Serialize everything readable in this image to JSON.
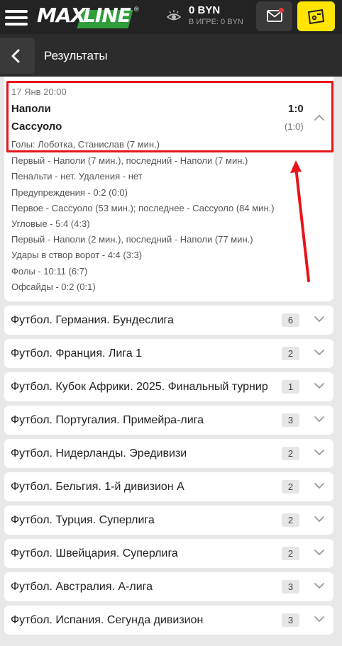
{
  "header": {
    "logo_text_1": "MAX",
    "logo_text_2": "LINE",
    "logo_reg": "®",
    "balance": "0 BYN",
    "in_game": "В ИГРЕ: 0 BYN",
    "colors": {
      "topbar": "#232323",
      "accent_yellow": "#ffe500",
      "logo_green": "#2f9d3c",
      "notify_red": "#e53935"
    }
  },
  "subheader": {
    "title": "Результаты"
  },
  "match": {
    "date": "17 Янв 20:00",
    "team1": "Наполи",
    "team2": "Сассуоло",
    "score": "1:0",
    "half_score": "(1:0)",
    "goals": "Голы: Лоботка, Станислав (7 мин.)",
    "details": [
      "Первый - Наполи (7 мин.), последний - Наполи (7 мин.)",
      "Пенальти - нет. Удаления - нет",
      "Предупреждения - 0:2 (0:0)",
      "Первое - Сассуоло (53 мин.); последнее - Сассуоло (84 мин.)",
      "Угловые - 5:4 (4:3)",
      "Первый - Наполи (2 мин.), последний - Наполи (77 мин.)",
      "Удары в створ ворот - 4:4 (3:3)",
      "Фолы - 10:11 (6:7)",
      "Офсайды - 0:2 (0:1)"
    ],
    "highlight_color": "#e8141b"
  },
  "leagues": [
    {
      "name": "Футбол. Германия. Бундеслига",
      "count": "6"
    },
    {
      "name": "Футбол. Франция. Лига 1",
      "count": "2"
    },
    {
      "name": "Футбол. Кубок Африки. 2025. Финальный турнир",
      "count": "1"
    },
    {
      "name": "Футбол. Португалия. Примейра-лига",
      "count": "3"
    },
    {
      "name": "Футбол. Нидерланды. Эредивизи",
      "count": "2"
    },
    {
      "name": "Футбол. Бельгия. 1-й дивизион А",
      "count": "2"
    },
    {
      "name": "Футбол. Турция. Суперлига",
      "count": "2"
    },
    {
      "name": "Футбол. Швейцария. Суперлига",
      "count": "2"
    },
    {
      "name": "Футбол. Австралия. А-лига",
      "count": "3"
    },
    {
      "name": "Футбол. Испания. Сегунда дивизион",
      "count": "3"
    }
  ]
}
